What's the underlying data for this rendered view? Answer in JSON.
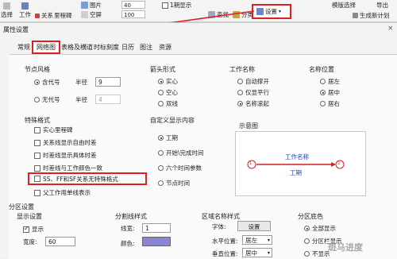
{
  "toolbar": {
    "left_items": [
      "选择",
      "工作",
      "关系",
      "里程碑"
    ],
    "mid_items": [
      "图片",
      "空屏"
    ],
    "spin_values": [
      "40",
      "100"
    ],
    "show_label": "1期显示",
    "right_items": [
      "查找",
      "分类"
    ],
    "settings_label": "设置",
    "far_items": [
      "模版选择",
      "导出"
    ],
    "new_schedule_label": "生成新计划"
  },
  "dialog": {
    "title": "属性设置",
    "tabs": [
      "常规",
      "网络图",
      "表格及横道",
      "时标刻度",
      "日历",
      "图注",
      "资源"
    ]
  },
  "node_style": {
    "title": "节点风格",
    "options": [
      "含代号",
      "无代号"
    ],
    "radius_label": "半径",
    "radius_values": [
      "9",
      "4"
    ]
  },
  "arrow_style": {
    "title": "箭头形式",
    "options": [
      "实心",
      "空心",
      "双线"
    ]
  },
  "work_name": {
    "title": "工作名称",
    "options": [
      "自动撑开",
      "仅显平行",
      "名称滚起"
    ]
  },
  "name_position": {
    "title": "名称位置",
    "options": [
      "居左",
      "居中",
      "居右"
    ]
  },
  "special_format": {
    "title": "特殊格式",
    "options": [
      "实心里程碑",
      "关系线显示自由时差",
      "时差线显示具体时差",
      "时差线与工作颜色一致",
      "SS、FF和SF关系无特殊格式",
      "父工作用单线表示"
    ]
  },
  "custom_content": {
    "title": "自定义显示内容",
    "options": [
      "工期",
      "开始\\完成时间",
      "六个时间参数",
      "节点时间"
    ]
  },
  "preview": {
    "title": "示意图",
    "node_a": "1",
    "node_b": "2",
    "top_text": "工作名称",
    "bottom_text": "工期"
  },
  "zone_settings": {
    "title": "分区设置",
    "display_settings": "显示设置",
    "show_label": "显示",
    "width_label": "宽度:",
    "width_value": "60",
    "border_title": "分割线样式",
    "line_type_label": "线宽:",
    "line_type_value": "1",
    "color_label": "颜色:",
    "color_value": "#8a85d0",
    "zone_name_title": "区域名称样式",
    "font_label": "字体:",
    "font_button": "设置",
    "hpos_label": "水平位置:",
    "hpos_value": "居左",
    "vpos_label": "垂直位置:",
    "vpos_value": "居中",
    "bg_title": "分区底色",
    "bg_options": [
      "全部显示",
      "分区栏显示",
      "不显示"
    ]
  },
  "watermark": {
    "text": "斑马进度"
  },
  "colors": {
    "accent_red": "#e02020",
    "link_blue": "#1a3fb0",
    "preview_red": "#d42020"
  }
}
